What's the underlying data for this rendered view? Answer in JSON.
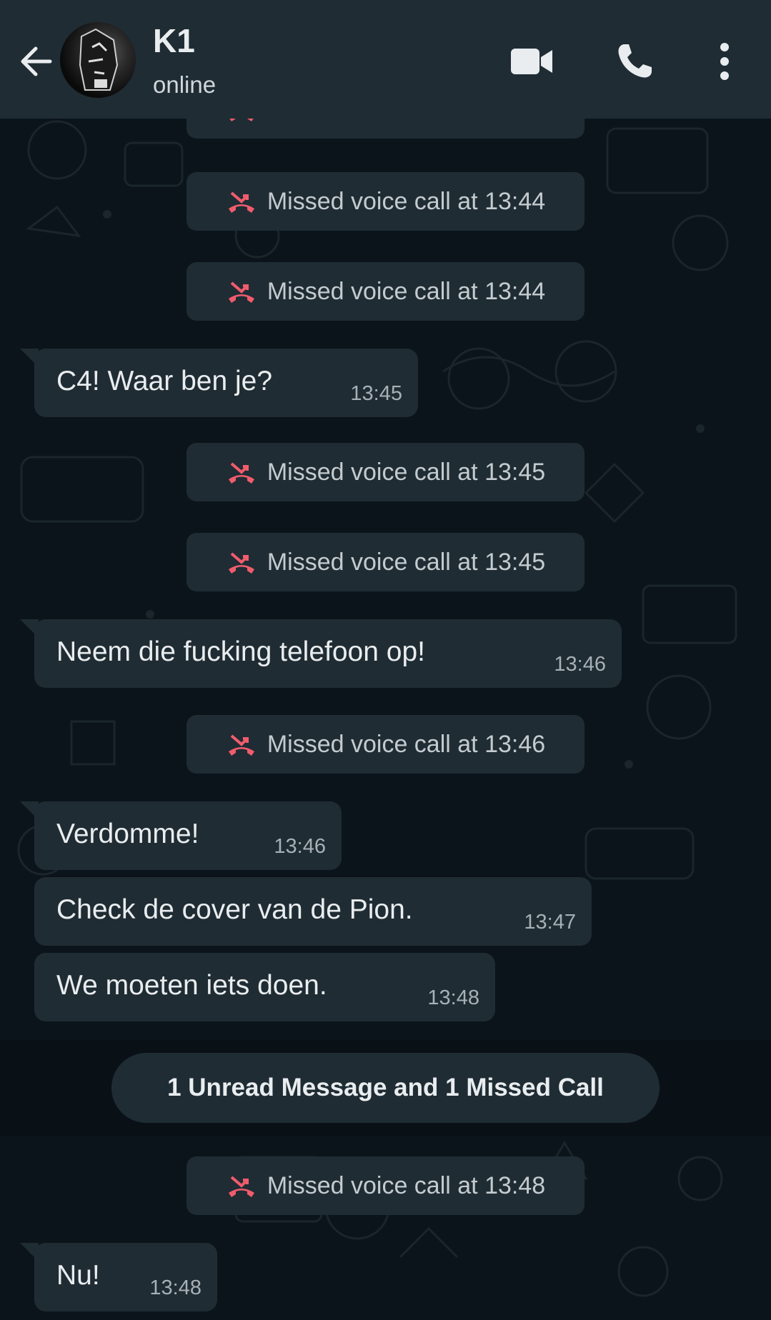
{
  "header": {
    "contact_name": "K1",
    "status": "online"
  },
  "icons": {
    "back": "arrow-left-icon",
    "video": "video-call-icon",
    "voice": "phone-icon",
    "menu": "more-vert-icon",
    "missed": "missed-call-icon"
  },
  "colors": {
    "header_bg": "#1f2c34",
    "chat_bg": "#0b141a",
    "bubble_bg": "#202c33",
    "missed_call_red": "#f15c6d"
  },
  "messages": [
    {
      "type": "system",
      "text": "Missed voice call at 13:44"
    },
    {
      "type": "system",
      "text": "Missed voice call at 13:44"
    },
    {
      "type": "system",
      "text": "Missed voice call at 13:44"
    },
    {
      "type": "incoming",
      "text": "C4! Waar ben je?",
      "time": "13:45"
    },
    {
      "type": "system",
      "text": "Missed voice call at 13:45"
    },
    {
      "type": "system",
      "text": "Missed voice call at 13:45"
    },
    {
      "type": "incoming",
      "text": "Neem die fucking telefoon op!",
      "time": "13:46"
    },
    {
      "type": "system",
      "text": "Missed voice call at 13:46"
    },
    {
      "type": "incoming",
      "text": "Verdomme!",
      "time": "13:46"
    },
    {
      "type": "incoming",
      "text": "Check de cover van de Pion.",
      "time": "13:47"
    },
    {
      "type": "incoming",
      "text": "We moeten iets doen.",
      "time": "13:48"
    },
    {
      "type": "unread_divider",
      "text": "1 Unread Message and 1 Missed Call"
    },
    {
      "type": "system",
      "text": "Missed voice call at 13:48"
    },
    {
      "type": "incoming",
      "text": "Nu!",
      "time": "13:48"
    }
  ]
}
